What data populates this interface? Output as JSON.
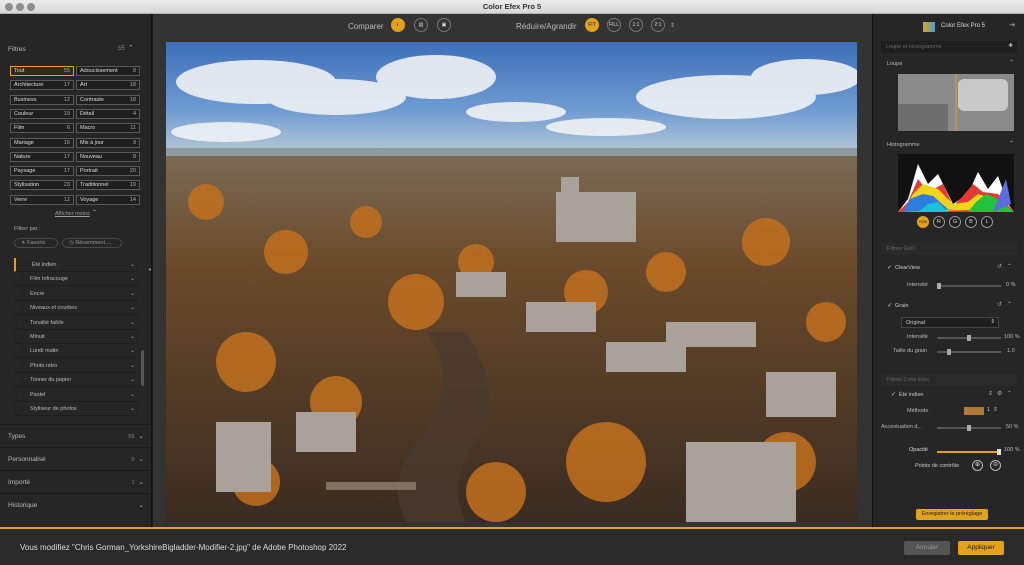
{
  "window": {
    "title": "Color Efex Pro 5"
  },
  "toolbar": {
    "compare_label": "Comparer",
    "zoom_label": "Réduire/Agrandir",
    "zoom_buttons": [
      "FIT",
      "FILL",
      "1:1",
      "2:1"
    ]
  },
  "left": {
    "filters_header": "Filtres",
    "filters_count": "55",
    "categories": [
      {
        "label": "Tout",
        "count": "55"
      },
      {
        "label": "Adoucissement",
        "count": "8"
      },
      {
        "label": "Architecture",
        "count": "17"
      },
      {
        "label": "Art",
        "count": "18"
      },
      {
        "label": "Business",
        "count": "12"
      },
      {
        "label": "Contraste",
        "count": "18"
      },
      {
        "label": "Couleur",
        "count": "19"
      },
      {
        "label": "Détail",
        "count": "4"
      },
      {
        "label": "Film",
        "count": "6"
      },
      {
        "label": "Macro",
        "count": "11"
      },
      {
        "label": "Mariage",
        "count": "16"
      },
      {
        "label": "Mis à jour",
        "count": "9"
      },
      {
        "label": "Nature",
        "count": "17"
      },
      {
        "label": "Nouveau",
        "count": "8"
      },
      {
        "label": "Paysage",
        "count": "17"
      },
      {
        "label": "Portrait",
        "count": "20"
      },
      {
        "label": "Stylisation",
        "count": "23"
      },
      {
        "label": "Traditionnel",
        "count": "19"
      },
      {
        "label": "Verre",
        "count": "12"
      },
      {
        "label": "Voyage",
        "count": "14"
      }
    ],
    "show_more": "Afficher moins",
    "filter_by": "Filtrer par :",
    "favorites": "Favoris",
    "recent": "Récemment ...",
    "filter_list": [
      "Été indien",
      "Film Infracouge",
      "Encre",
      "Niveaux et courbes",
      "Tonalité faible",
      "Minuit",
      "Lundi matin",
      "Photo rétro",
      "Tonner du papier",
      "Pastel",
      "Styliseur de photos"
    ],
    "sections": [
      {
        "title": "Types",
        "count": "55"
      },
      {
        "title": "Personnalisé",
        "count": "0"
      },
      {
        "title": "Importé",
        "count": "1"
      },
      {
        "title": "Historique",
        "count": ""
      }
    ]
  },
  "right": {
    "logo": "Color Efex Pro 5",
    "loupe_hint": "Loupe et Histogramme",
    "loupe": "Loupe",
    "histogram": "Histogramme",
    "channels": [
      "RGB",
      "R",
      "G",
      "B",
      "L"
    ],
    "global_filters": "Filtres GxO",
    "clearview": "ClearView",
    "intensity": "Intensité",
    "clearview_value": "0 %",
    "grain": "Grain",
    "grain_mode": "Original",
    "grain_intensity": "100 %",
    "grain_size_label": "Taille du grain",
    "grain_size": "1.0",
    "color_efex": "Filtres Color Efex",
    "ete_indien": "Été indien",
    "methode": "Méthode",
    "methode_value": "1",
    "accentuation": "Accentuation d...",
    "accentuation_value": "50 %",
    "opacite": "Opacité",
    "opacite_value": "100 %",
    "points": "Points de contrôle",
    "save_preset": "Enregistrer le préréglage"
  },
  "bottom": {
    "message": "Vous modifiez \"Chris Gorman_YorkshireBigladder-Modifier-2.jpg\" de Adobe Photoshop 2022",
    "cancel": "Annuler",
    "apply": "Appliquer"
  },
  "colors": {
    "accent": "#e4a11b",
    "panel": "#262626",
    "canvas": "#333333"
  }
}
